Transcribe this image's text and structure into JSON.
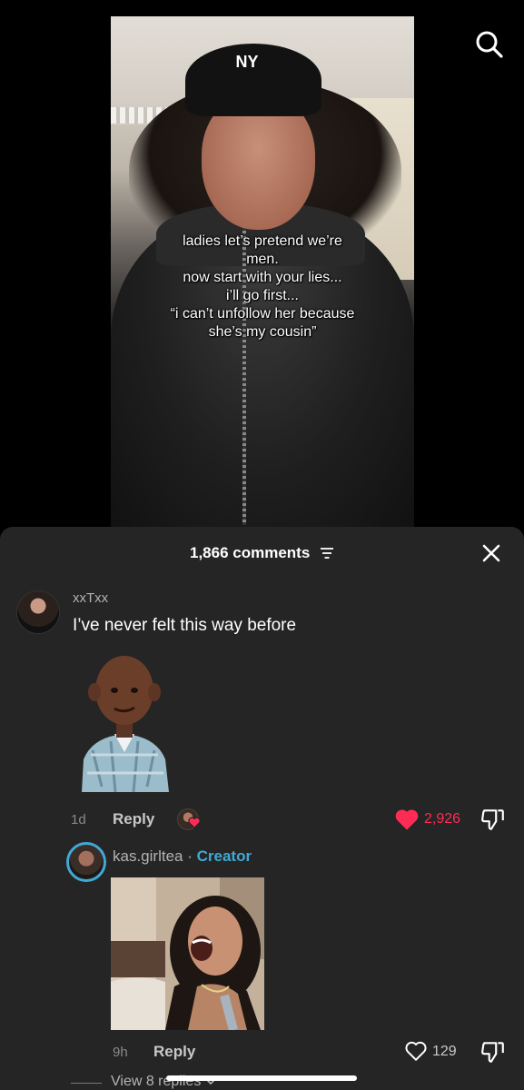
{
  "video": {
    "overlay_lines": [
      "ladies let’s pretend we’re",
      "men.",
      "now start with your lies...",
      "i’ll go first...",
      "“i can’t unfollow her because",
      "she’s my cousin”"
    ],
    "cap_logo": "NY"
  },
  "comments_sheet": {
    "count_label": "1,866 comments"
  },
  "comments": [
    {
      "username": "xxTxx",
      "text": "I’ve never felt this way before",
      "time": "1d",
      "reply_label": "Reply",
      "like_count": "2,926",
      "liked": true
    }
  ],
  "reply": {
    "username": "kas.girltea",
    "separator": "·",
    "creator_label": "Creator",
    "time": "9h",
    "reply_label": "Reply",
    "like_count": "129",
    "liked": false,
    "view_replies_label": "View 8 replies"
  },
  "colors": {
    "sheet_bg": "#252525",
    "like_red": "#fe2c55",
    "creator_blue": "#3fa9d6"
  }
}
